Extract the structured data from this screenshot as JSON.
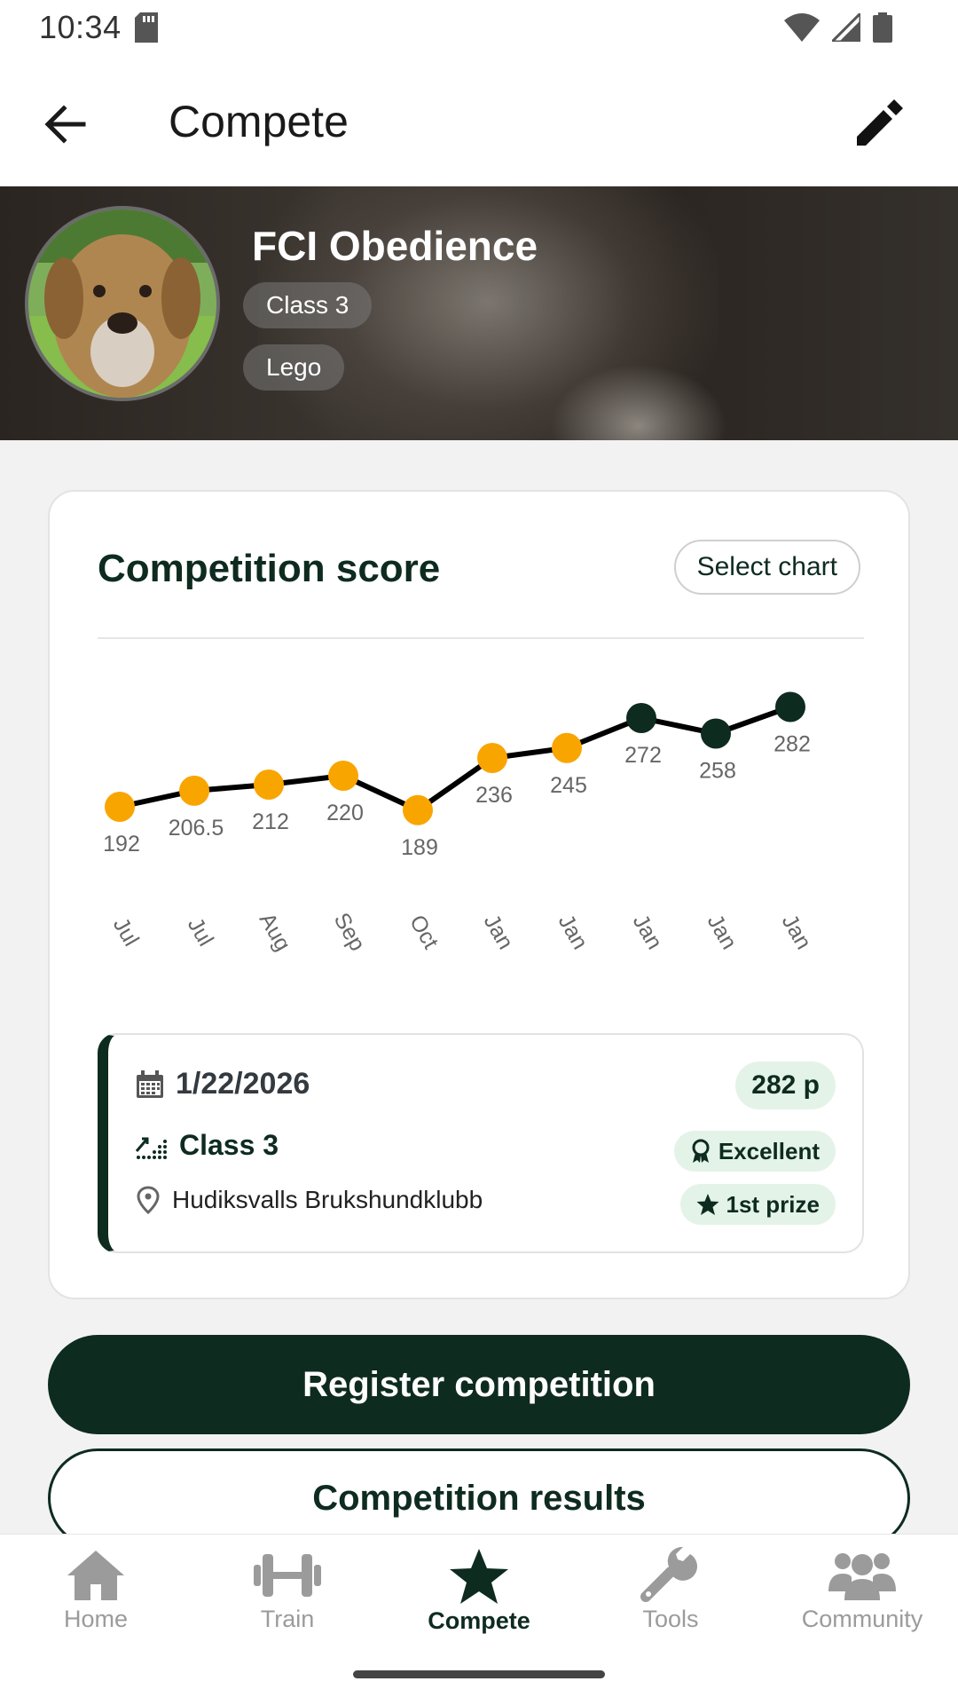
{
  "status_bar": {
    "time": "10:34"
  },
  "app_bar": {
    "title": "Compete"
  },
  "hero": {
    "title": "FCI Obedience",
    "chips": [
      "Class 3",
      "Lego"
    ]
  },
  "score_card": {
    "title": "Competition score",
    "select_chart_label": "Select chart"
  },
  "chart_data": {
    "type": "line",
    "categories": [
      "Jul",
      "Jul",
      "Aug",
      "Sep",
      "Oct",
      "Jan",
      "Jan",
      "Jan",
      "Jan",
      "Jan"
    ],
    "values": [
      192,
      206.5,
      212,
      220,
      189,
      236,
      245,
      272,
      258,
      282
    ],
    "labels": [
      "192",
      "206.5",
      "212",
      "220",
      "189",
      "236",
      "245",
      "272",
      "258",
      "282"
    ],
    "point_colors": [
      "#f9a500",
      "#f9a500",
      "#f9a500",
      "#f9a500",
      "#f9a500",
      "#f9a500",
      "#f9a500",
      "#0e2b20",
      "#0e2b20",
      "#0e2b20"
    ],
    "line_color": "#000000",
    "grid": false
  },
  "result": {
    "date": "1/22/2026",
    "class": "Class 3",
    "place": "Hudiksvalls Brukshundklubb",
    "score": "282 p",
    "grade": "Excellent",
    "prize": "1st prize"
  },
  "buttons": {
    "register": "Register competition",
    "results": "Competition results"
  },
  "nav": {
    "items": [
      {
        "label": "Home",
        "icon": "home-icon"
      },
      {
        "label": "Train",
        "icon": "dumbbell-icon"
      },
      {
        "label": "Compete",
        "icon": "star-icon"
      },
      {
        "label": "Tools",
        "icon": "wrench-icon"
      },
      {
        "label": "Community",
        "icon": "people-icon"
      }
    ],
    "active": "Compete"
  },
  "colors": {
    "primary": "#0e2b20",
    "accent": "#f9a500",
    "pill_bg": "#e4f3e8"
  }
}
